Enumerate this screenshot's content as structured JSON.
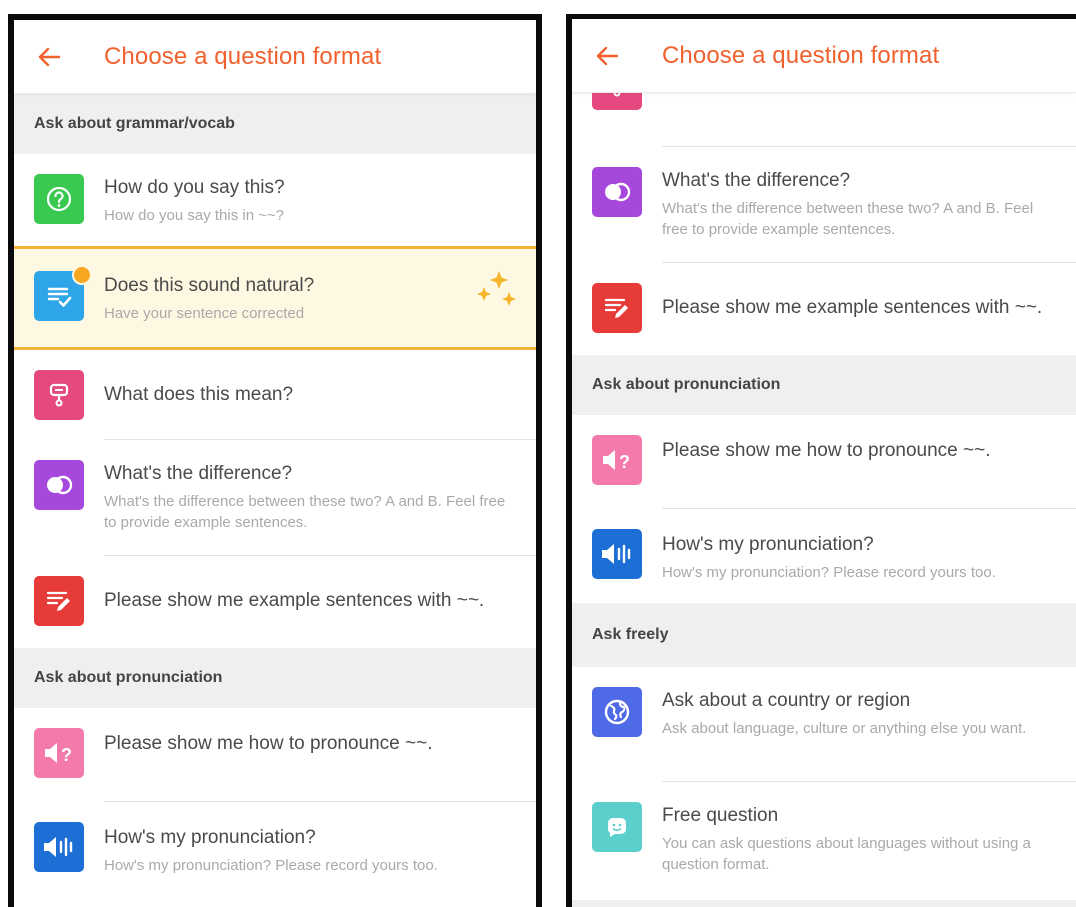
{
  "screen_title": "Choose a question format",
  "colors": {
    "accent": "#f0612e",
    "highlight_bg": "#fef8e3",
    "highlight_border": "#f4b234"
  },
  "left": {
    "sections": {
      "grammar": "Ask about grammar/vocab",
      "pronunciation": "Ask about pronunciation"
    },
    "items": [
      {
        "title": "How do you say this?",
        "subtitle": "How do you say this in ~~?",
        "icon": "question-circle-icon"
      },
      {
        "title": "Does this sound natural?",
        "subtitle": "Have your sentence corrected",
        "icon": "checklist-icon",
        "highlighted": true
      },
      {
        "title": "What does this mean?",
        "icon": "magnifier-icon"
      },
      {
        "title": "What's the difference?",
        "subtitle": "What's the difference between these two? A and B. Feel free to provide example sentences.",
        "icon": "overlap-circles-icon"
      },
      {
        "title": "Please show me example sentences with ~~.",
        "icon": "list-pencil-icon"
      },
      {
        "title": "Please show me how to pronounce ~~.",
        "icon": "speaker-question-icon"
      },
      {
        "title": "How's my pronunciation?",
        "subtitle": "How's my pronunciation? Please record yours too.",
        "icon": "speaker-wave-icon"
      }
    ]
  },
  "right": {
    "sections": {
      "pronunciation": "Ask about pronunciation",
      "free": "Ask freely"
    },
    "items": [
      {
        "title": "What's the difference?",
        "subtitle": "What's the difference between these two? A and B. Feel free to provide example sentences.",
        "icon": "overlap-circles-icon"
      },
      {
        "title": "Please show me example sentences with ~~.",
        "icon": "list-pencil-icon"
      },
      {
        "title": "Please show me how to pronounce ~~.",
        "icon": "speaker-question-icon"
      },
      {
        "title": "How's my pronunciation?",
        "subtitle": "How's my pronunciation? Please record yours too.",
        "icon": "speaker-wave-icon"
      },
      {
        "title": "Ask about a country or region",
        "subtitle": "Ask about language, culture or anything else you want.",
        "icon": "globe-icon"
      },
      {
        "title": "Free question",
        "subtitle": "You can ask questions about languages without using a question format.",
        "icon": "chat-face-icon"
      }
    ]
  }
}
